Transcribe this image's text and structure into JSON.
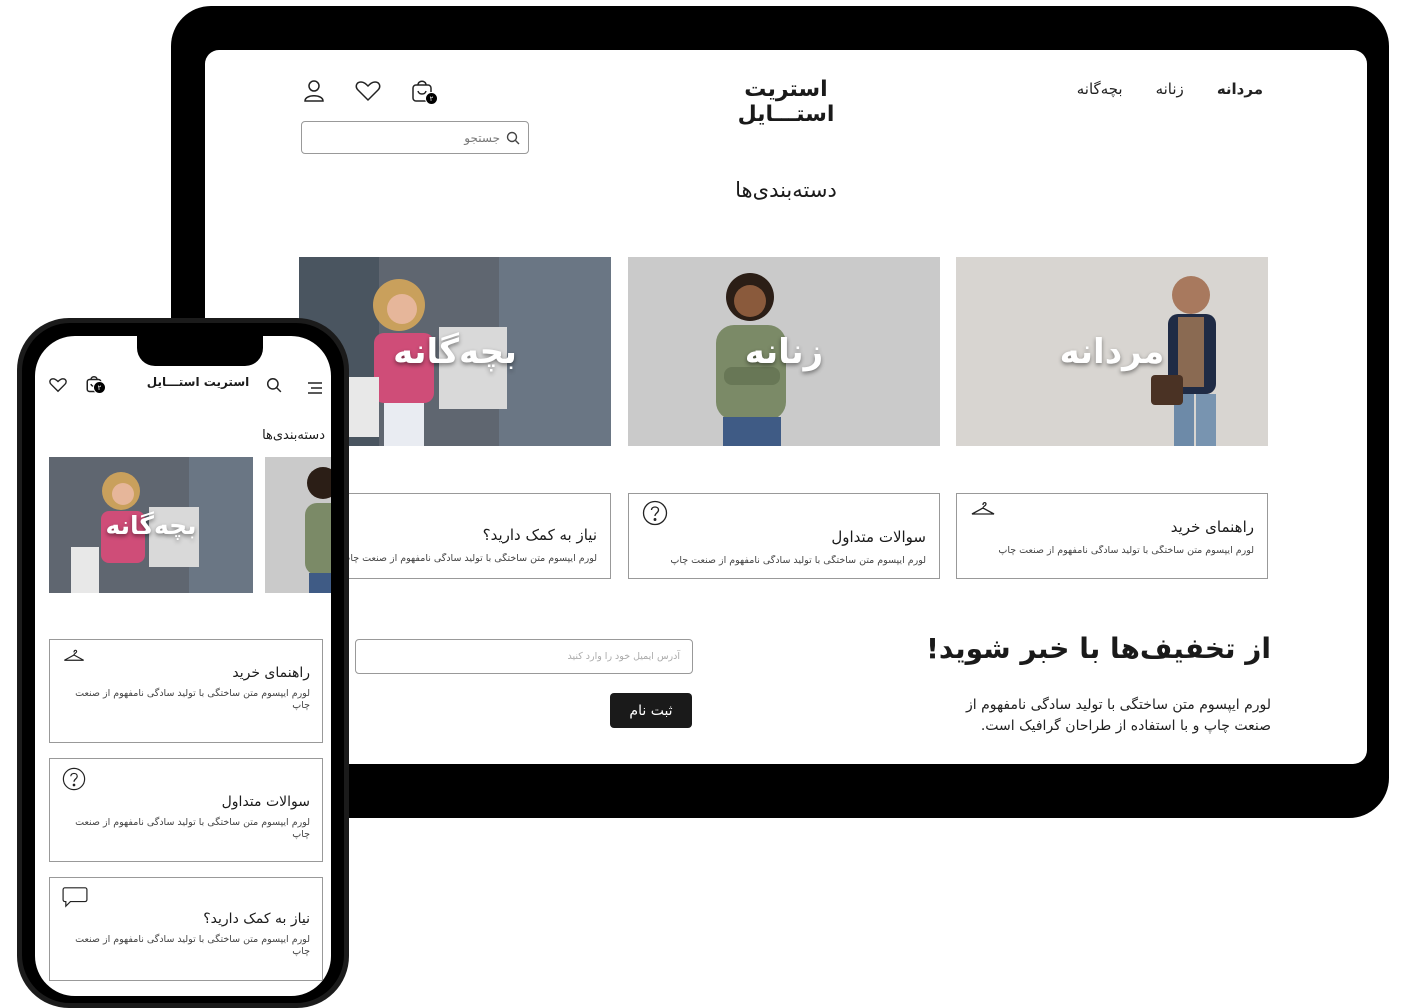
{
  "desktop": {
    "nav": [
      "مردانه",
      "زنانه",
      "بچه‌گانه"
    ],
    "logo": "استریت استـــایل",
    "cart_count": "۲",
    "search_placeholder": "جستجو",
    "categories_title": "دسته‌بندی‌ها",
    "categories": [
      "مردانه",
      "زنانه",
      "بچه‌گانه"
    ],
    "info_cards": [
      {
        "title": "راهنمای خرید",
        "desc": "لورم ایپسوم متن ساختگی با تولید سادگی نامفهوم از صنعت چاپ",
        "icon": "hanger-icon"
      },
      {
        "title": "سوالات متداول",
        "desc": "لورم ایپسوم متن ساختگی با تولید سادگی نامفهوم از صنعت چاپ",
        "icon": "question-icon"
      },
      {
        "title": "نیاز به کمک دارید؟",
        "desc": "لورم ایپسوم متن ساختگی با تولید سادگی نامفهوم از صنعت چاپ",
        "icon": "chat-icon"
      }
    ],
    "newsletter": {
      "title": "از تخفیف‌ها با خبر شوید!",
      "text": "لورم ایپسوم متن ساختگی با تولید سادگی نامفهوم از صنعت چاپ و با استفاده از طراحان گرافیک است.",
      "email_placeholder": "آدرس ایمیل خود را وارد کنید",
      "submit": "ثبت نام"
    }
  },
  "mobile": {
    "logo": "استریت استـــایل",
    "cart_count": "۲",
    "categories_title": "دسته‌بندی‌ها",
    "category": "بچه‌گانه",
    "info_cards": [
      {
        "title": "راهنمای خرید",
        "desc": "لورم ایپسوم متن ساختگی با تولید سادگی نامفهوم از صنعت چاپ"
      },
      {
        "title": "سوالات متداول",
        "desc": "لورم ایپسوم متن ساختگی با تولید سادگی نامفهوم از صنعت چاپ"
      },
      {
        "title": "نیاز به کمک دارید؟",
        "desc": "لورم ایپسوم متن ساختگی با تولید سادگی نامفهوم از صنعت چاپ"
      }
    ]
  },
  "colors": {
    "accent": "#1a1a1a",
    "border": "#999999",
    "frame": "#000000"
  }
}
